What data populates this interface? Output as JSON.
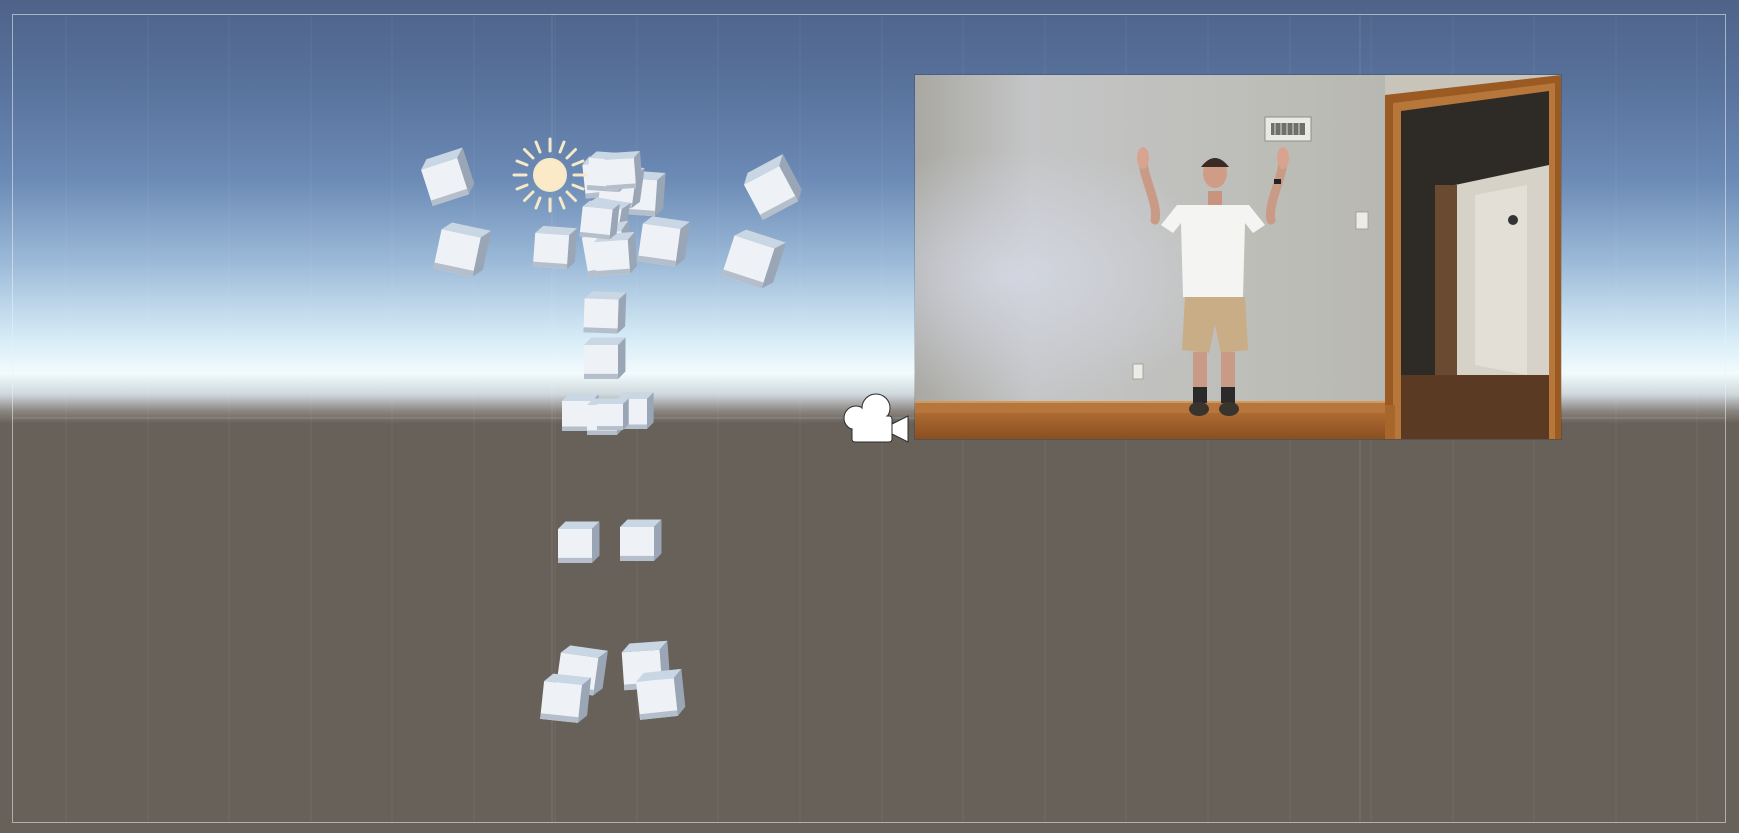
{
  "scene_view": {
    "title": "",
    "sky_colors": {
      "top": "#4f6389",
      "horizon": "#f2fbfd",
      "ground": "#686159"
    },
    "frame_color": "#dfe6f0",
    "gizmos": [
      {
        "name": "directional-light",
        "icon": "sun-icon",
        "color": "#f4e9c8"
      },
      {
        "name": "main-camera",
        "icon": "camera-icon",
        "color": "#ffffff"
      }
    ],
    "skeleton": {
      "joint_count": 27,
      "joint_color": "#e9eef4"
    },
    "video_overlay": {
      "description_visible_text": "",
      "wall_color": "#bdbcb6",
      "floor_color": "#a9672f",
      "door_trim_color": "#a8672a"
    }
  }
}
